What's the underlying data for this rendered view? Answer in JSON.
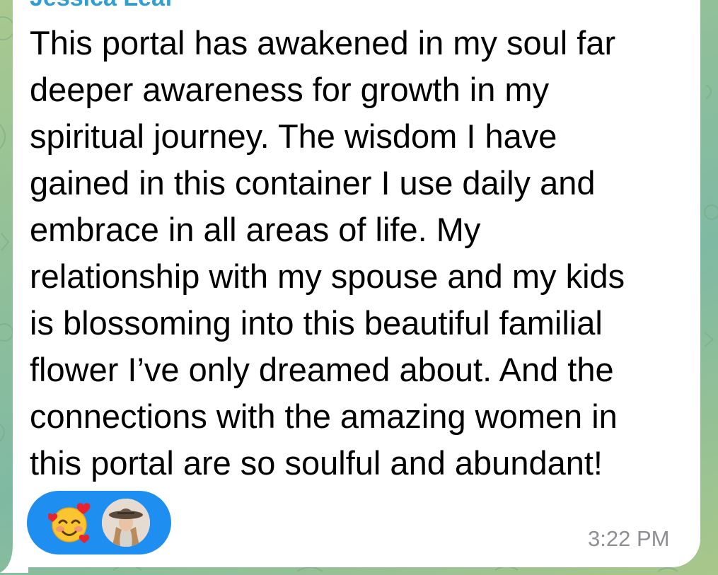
{
  "message": {
    "sender": "Jessica Leaf",
    "lines": [
      "This portal has awakened in my soul far",
      "deeper awareness for growth in my",
      "spiritual journey. The wisdom I have",
      "gained in this container I use daily and",
      "embrace in all areas of life. My",
      "relationship with my spouse and my kids",
      "is blossoming into this beautiful familial",
      "flower I’ve only dreamed about. And the",
      "connections with the amazing women in",
      "this portal are so soulful and abundant!"
    ],
    "time": "3:22 PM"
  },
  "reaction": {
    "emoji_icon": "smiling-face-with-hearts-icon",
    "reactor_avatar": "avatar-woman-with-hat",
    "pill_color": "#1e8ff0"
  },
  "colors": {
    "sender": "#2f9fd3",
    "bubble": "#ffffff",
    "timestamp": "#8e8e93",
    "background": "#8fbf9a"
  }
}
